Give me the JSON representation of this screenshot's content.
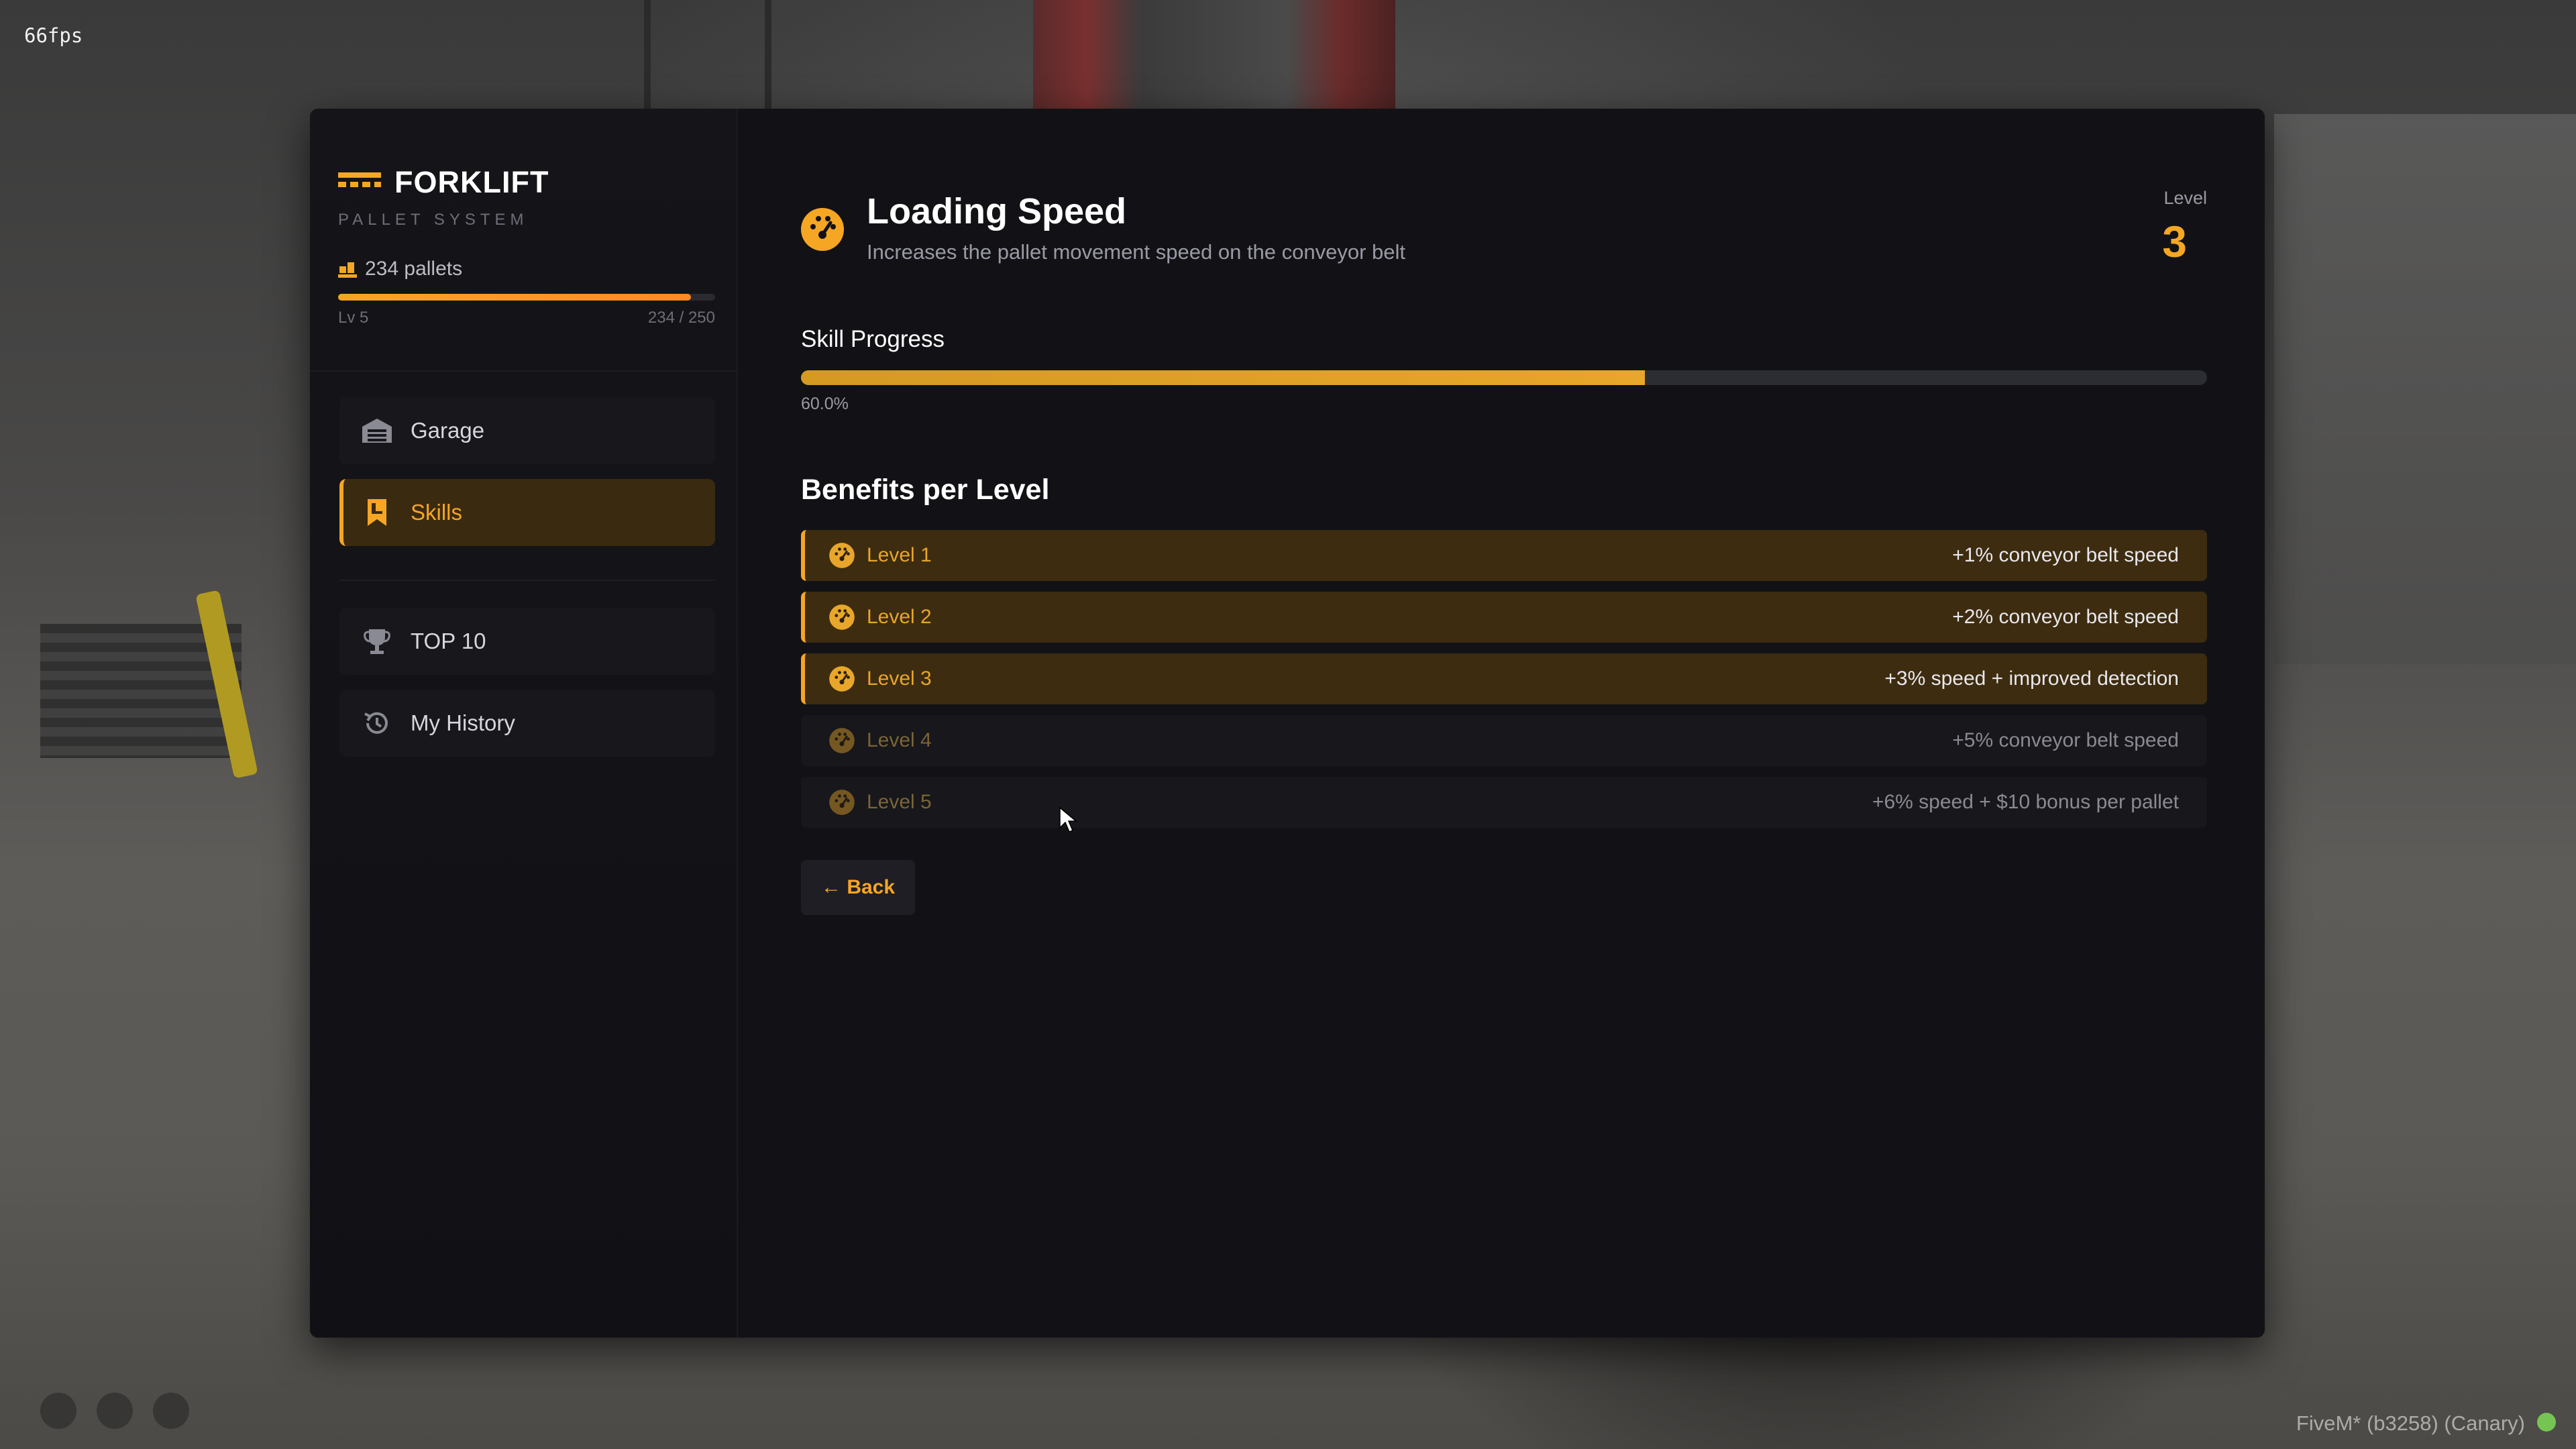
{
  "overlay": {
    "fps": "66fps",
    "platform": "FiveM* (b3258) (Canary)"
  },
  "brand": {
    "title": "FORKLIFT",
    "subtitle": "PALLET SYSTEM",
    "icon": "forklift-icon"
  },
  "stats": {
    "pallets": "234 pallets",
    "level": "Lv 5",
    "progress_text": "234 / 250",
    "progress_fraction": 0.936
  },
  "sidebar": {
    "items": [
      {
        "label": "Garage",
        "icon": "warehouse-icon",
        "active": false
      },
      {
        "label": "Skills",
        "icon": "bookmark-icon",
        "active": true
      },
      {
        "label": "TOP 10",
        "icon": "trophy-icon",
        "active": false
      },
      {
        "label": "My History",
        "icon": "history-icon",
        "active": false
      }
    ]
  },
  "skill": {
    "icon": "speedometer-icon",
    "title": "Loading Speed",
    "description": "Increases the pallet movement speed on the conveyor belt",
    "level_label": "Level",
    "level_value": "3",
    "progress_title": "Skill Progress",
    "progress_percent_text": "60.0%",
    "progress_fraction": 0.6
  },
  "benefits": {
    "title": "Benefits per Level",
    "items": [
      {
        "name": "Level 1",
        "value": "+1% conveyor belt speed",
        "unlocked": true
      },
      {
        "name": "Level 2",
        "value": "+2% conveyor belt speed",
        "unlocked": true
      },
      {
        "name": "Level 3",
        "value": "+3% speed + improved detection",
        "unlocked": true
      },
      {
        "name": "Level 4",
        "value": "+5% conveyor belt speed",
        "unlocked": false
      },
      {
        "name": "Level 5",
        "value": "+6% speed + $10 bonus per pallet",
        "unlocked": false
      }
    ]
  },
  "back_label": "← Back",
  "colors": {
    "accent": "#f5a623",
    "panel_bg": "#121216",
    "unlocked_row_bg": "#3d2c0f"
  }
}
